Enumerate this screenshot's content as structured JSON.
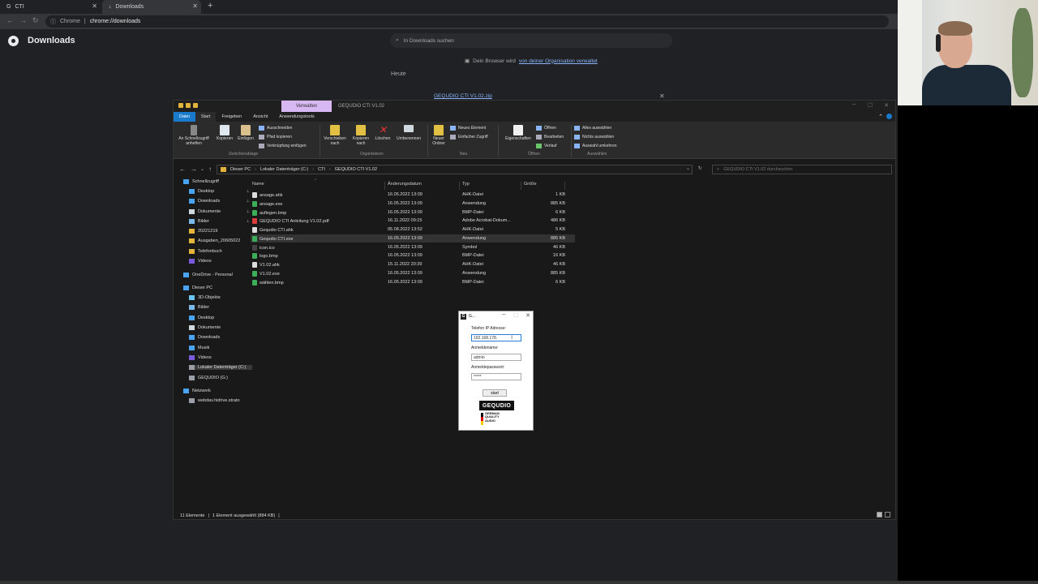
{
  "chrome": {
    "tabs": [
      {
        "label": "CTI"
      },
      {
        "label": "Downloads"
      }
    ],
    "new_tab": "+",
    "close": "✕",
    "omnibox": {
      "scheme": "Chrome",
      "separator": "|",
      "url": "chrome://downloads"
    }
  },
  "downloads_page": {
    "title": "Downloads",
    "search_placeholder": "In Downloads suchen",
    "managed_text": "Dein Browser wird",
    "managed_link": "von deiner Organisation verwaltet",
    "today_label": "Heute",
    "file_name": "GEQUDIO CTI V1.02.zip"
  },
  "explorer": {
    "context_tab": "Verwalten",
    "window_title": "GEQUDIO CTI V1.02",
    "ribbon_tabs": [
      "Datei",
      "Start",
      "Freigeben",
      "Ansicht",
      "Anwendungstools"
    ],
    "ribbon": {
      "pin": "An Schnellzugriff anheften",
      "copy": "Kopieren",
      "paste": "Einfügen",
      "cut": "Ausschneiden",
      "copy_path": "Pfad kopieren",
      "paste_shortcut": "Verknüpfung einfügen",
      "move_to": "Verschieben nach",
      "copy_to": "Kopieren nach",
      "delete": "Löschen",
      "rename": "Umbenennen",
      "new_folder": "Neuer Ordner",
      "new_item": "Neues Element",
      "easy_access": "Einfacher Zugriff",
      "properties": "Eigenschaften",
      "open": "Öffnen",
      "edit": "Bearbeiten",
      "history": "Verlauf",
      "select_all": "Alles auswählen",
      "select_none": "Nichts auswählen",
      "invert_selection": "Auswahl umkehren",
      "groups": [
        "Zwischenablage",
        "Organisieren",
        "Neu",
        "Öffnen",
        "Auswählen"
      ]
    },
    "path": [
      "Dieser PC",
      "Lokaler Datenträger (C:)",
      "CTI",
      "GEQUDIO CTI V1.02"
    ],
    "search_placeholder": "GEQUDIO CTI V1.02 durchsuchen",
    "sidebar": [
      {
        "label": "Schnellzugriff",
        "color": "#4aa3f0",
        "pin": false,
        "indent": 0
      },
      {
        "label": "Desktop",
        "color": "#4aa3f0",
        "pin": true,
        "indent": 1
      },
      {
        "label": "Downloads",
        "color": "#4aa3f0",
        "pin": true,
        "indent": 1
      },
      {
        "label": "Dokumente",
        "color": "#cfd8dc",
        "pin": true,
        "indent": 1
      },
      {
        "label": "Bilder",
        "color": "#7ab8e8",
        "pin": true,
        "indent": 1
      },
      {
        "label": "20221219",
        "color": "#e2b43c",
        "pin": false,
        "indent": 1
      },
      {
        "label": "Ausgaben_20605022",
        "color": "#e2b43c",
        "pin": false,
        "indent": 1
      },
      {
        "label": "Telefonbuch",
        "color": "#e2b43c",
        "pin": false,
        "indent": 1
      },
      {
        "label": "Videos",
        "color": "#7a5ad8",
        "pin": false,
        "indent": 1
      },
      {
        "label": "OneDrive - Personal",
        "color": "#4aa3f0",
        "pin": false,
        "indent": 0
      },
      {
        "label": "Dieser PC",
        "color": "#4aa3f0",
        "pin": false,
        "indent": 0
      },
      {
        "label": "3D-Objekte",
        "color": "#6ac6f0",
        "pin": false,
        "indent": 1
      },
      {
        "label": "Bilder",
        "color": "#7ab8e8",
        "pin": false,
        "indent": 1
      },
      {
        "label": "Desktop",
        "color": "#4aa3f0",
        "pin": false,
        "indent": 1
      },
      {
        "label": "Dokumente",
        "color": "#cfd8dc",
        "pin": false,
        "indent": 1
      },
      {
        "label": "Downloads",
        "color": "#4aa3f0",
        "pin": false,
        "indent": 1
      },
      {
        "label": "Musik",
        "color": "#4aa3f0",
        "pin": false,
        "indent": 1
      },
      {
        "label": "Videos",
        "color": "#7a5ad8",
        "pin": false,
        "indent": 1
      },
      {
        "label": "Lokaler Datenträger (C:)",
        "color": "#9aa0a6",
        "pin": false,
        "indent": 1,
        "selected": true
      },
      {
        "label": "GEQUDIO (G:)",
        "color": "#9aa0a6",
        "pin": false,
        "indent": 1
      },
      {
        "label": "Netzwerk",
        "color": "#4aa3f0",
        "pin": false,
        "indent": 0
      },
      {
        "label": "webdav.hidrive.strato",
        "color": "#9aa0a6",
        "pin": false,
        "indent": 1
      }
    ],
    "columns": [
      "Name",
      "Änderungsdatum",
      "Typ",
      "Größe"
    ],
    "files": [
      {
        "name": "ansage.ahk",
        "date": "16.05.2022 13:09",
        "type": "AHK-Datei",
        "size": "1 KB",
        "color": "#dddddd"
      },
      {
        "name": "ansage.exe",
        "date": "16.05.2022 13:09",
        "type": "Anwendung",
        "size": "885 KB",
        "color": "#3cae5a"
      },
      {
        "name": "auflegen.bmp",
        "date": "16.05.2022 13:09",
        "type": "BMP-Datei",
        "size": "6 KB",
        "color": "#3cae5a"
      },
      {
        "name": "GEQUDIO CTI Anleitung V1.02.pdf",
        "date": "16.11.2022 09:15",
        "type": "Adobe Acrobat-Dokum...",
        "size": "486 KB",
        "color": "#d93c3c"
      },
      {
        "name": "Gequdio CTI.ahk",
        "date": "05.08.2022 13:52",
        "type": "AHK-Datei",
        "size": "5 KB",
        "color": "#dddddd"
      },
      {
        "name": "Gequdio CTI.exe",
        "date": "16.05.2022 13:09",
        "type": "Anwendung",
        "size": "885 KB",
        "color": "#3cae5a",
        "selected": true
      },
      {
        "name": "icon.ico",
        "date": "16.05.2022 13:09",
        "type": "Symbol",
        "size": "46 KB",
        "color": "#444444"
      },
      {
        "name": "logo.bmp",
        "date": "16.05.2022 13:09",
        "type": "BMP-Datei",
        "size": "16 KB",
        "color": "#3cae5a"
      },
      {
        "name": "V1.02.ahk",
        "date": "15.11.2022 20:39",
        "type": "AHK-Datei",
        "size": "46 KB",
        "color": "#dddddd"
      },
      {
        "name": "V1.02.exe",
        "date": "16.05.2022 13:09",
        "type": "Anwendung",
        "size": "885 KB",
        "color": "#3cae5a"
      },
      {
        "name": "wählen.bmp",
        "date": "16.05.2022 13:09",
        "type": "BMP-Datei",
        "size": "6 KB",
        "color": "#3cae5a"
      }
    ],
    "status": {
      "count": "11 Elemente",
      "sep": "|",
      "selected": "1 Element ausgewählt (884 KB)"
    }
  },
  "dialog": {
    "title": "G...",
    "ip_label": "Telefon IP Adresse:",
    "ip_value": "192.168.178.",
    "user_label": "Anmeldename:",
    "user_value": "admin",
    "pass_label": "Anmeldepasswort:",
    "pass_value": "*****",
    "start_label": "start",
    "logo_text": "GEQUDIO",
    "logo_sub": [
      "GERMAN",
      "QUALITY",
      "AUDIO"
    ]
  },
  "icons": {
    "chrome_tab": "G",
    "download_tab": "↓",
    "back": "←",
    "forward": "→",
    "reload": "↻",
    "info": "ⓘ",
    "search": "⌕",
    "dropdown": "⌄",
    "refresh": "↻",
    "up": "↑",
    "minimize": "─",
    "maximize": "☐",
    "close": "✕",
    "collapse": "⌃",
    "pin": "📌",
    "building": "▣",
    "sort": "⌃",
    "cursor": "I"
  }
}
